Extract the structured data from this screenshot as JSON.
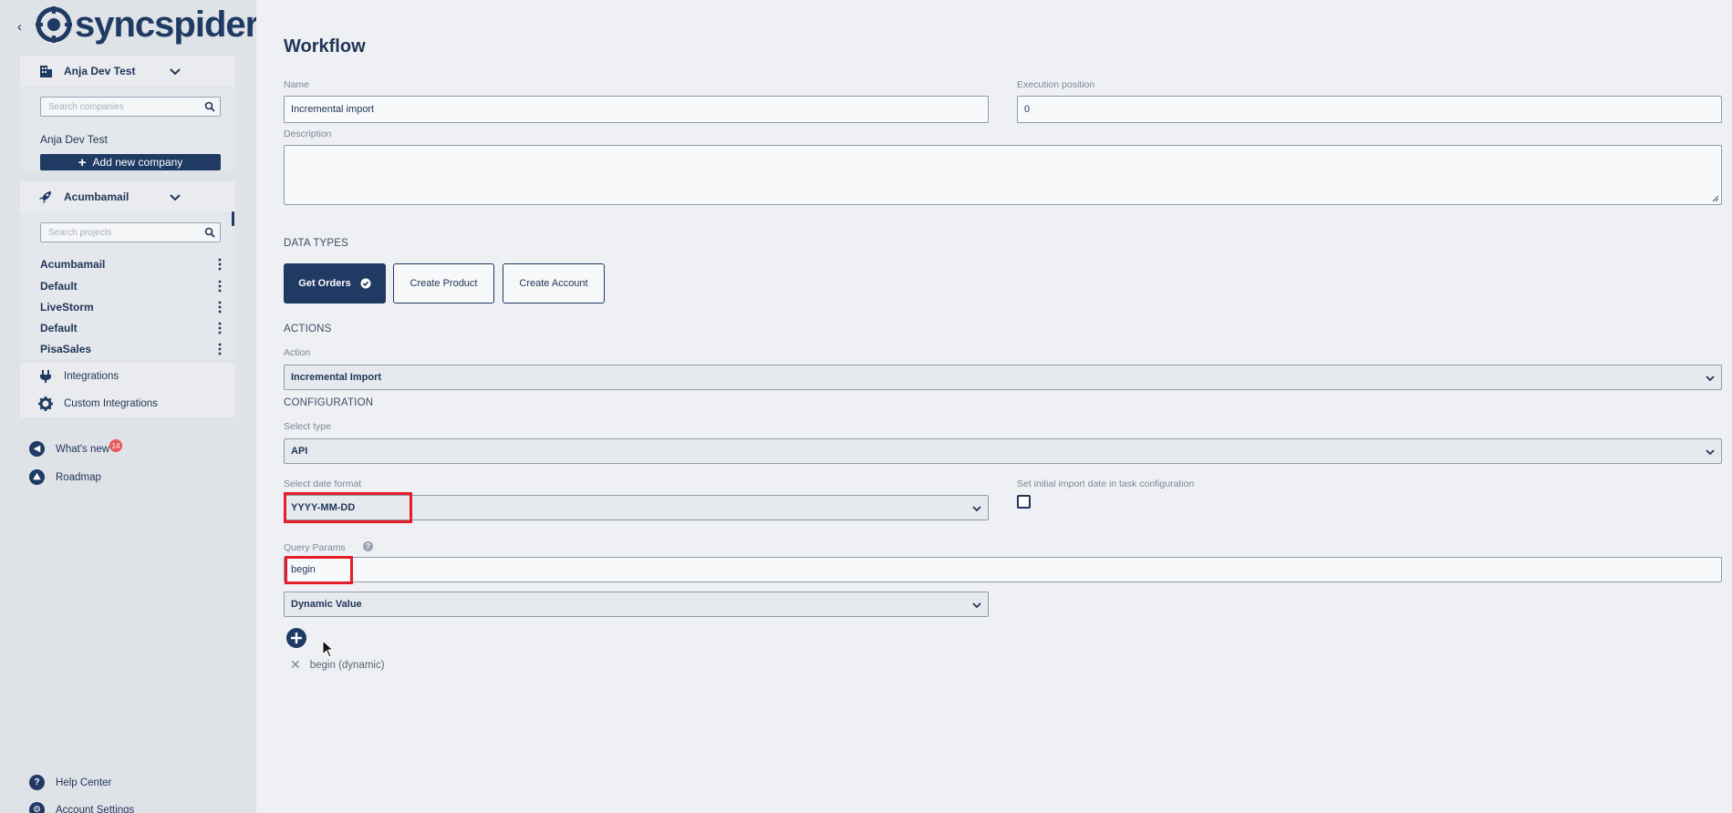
{
  "brand": {
    "logo_text": "syncspider"
  },
  "sidebar": {
    "company_selector": "Anja Dev Test",
    "company_search_placeholder": "Search companies",
    "company_name": "Anja Dev Test",
    "add_company_label": "Add new company",
    "project_selector": "Acumbamail",
    "project_search_placeholder": "Search projects",
    "projects": [
      {
        "label": "Acumbamail"
      },
      {
        "label": "Default"
      },
      {
        "label": "LiveStorm"
      },
      {
        "label": "Default"
      },
      {
        "label": "PisaSales"
      }
    ],
    "integrations_label": "Integrations",
    "custom_integrations_label": "Custom Integrations",
    "whats_new_label": "What's new",
    "whats_new_badge": "14",
    "roadmap_label": "Roadmap",
    "help_center_label": "Help Center",
    "account_settings_label": "Account Settings"
  },
  "workflow": {
    "title": "Workflow",
    "name_label": "Name",
    "name_value": "Incremental import",
    "exec_label": "Execution position",
    "exec_value": "0",
    "description_label": "Description",
    "data_types_heading": "DATA TYPES",
    "data_types": [
      {
        "label": "Get Orders",
        "active": true
      },
      {
        "label": "Create Product",
        "active": false
      },
      {
        "label": "Create Account",
        "active": false
      }
    ],
    "actions_heading": "ACTIONS",
    "action_label": "Action",
    "action_value": "Incremental Import",
    "configuration_heading": "CONFIGURATION",
    "select_type_label": "Select type",
    "select_type_value": "API",
    "date_format_label": "Select date format",
    "date_format_value": "YYYY-MM-DD",
    "initial_import_label": "Set initial import date in task configuration",
    "query_params_label": "Query Params",
    "query_param_value": "begin",
    "value_type": "Dynamic Value",
    "added_param": "begin (dynamic)"
  },
  "colors": {
    "primary": "#1f3a63",
    "highlight": "#e41e26",
    "badge": "#e75a5a"
  }
}
